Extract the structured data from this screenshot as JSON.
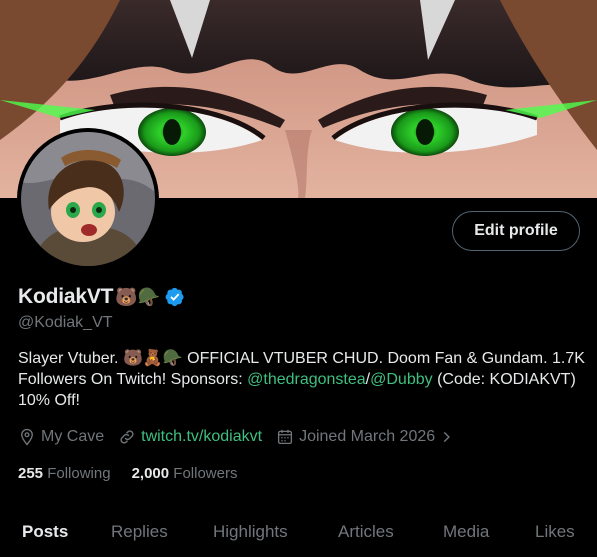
{
  "profile": {
    "display_name": "KodiakVT",
    "name_emojis": "🐻🪖",
    "handle": "@Kodiak_VT",
    "edit_button": "Edit profile",
    "bio_part1": "Slayer Vtuber. ",
    "bio_emojis": "🐻🧸🪖",
    "bio_part2": " OFFICIAL VTUBER CHUD.  Doom Fan & Gundam. 1.7K Followers On Twitch!  Sponsors: ",
    "mention1": "@thedragonstea",
    "slash": "/",
    "mention2": "@Dubby",
    "bio_part3": " (Code: KODIAKVT) 10% Off!",
    "location": "My Cave",
    "website": "twitch.tv/kodiakvt",
    "joined": "Joined March 2026",
    "following_count": "255",
    "following_label": "Following",
    "followers_count": "2,000",
    "followers_label": "Followers"
  },
  "tabs": [
    "Posts",
    "Replies",
    "Highlights",
    "Articles",
    "Media",
    "Likes"
  ],
  "active_tab": "Posts",
  "colors": {
    "accent": "#1d9bf0",
    "link_green": "#3fbf7f",
    "muted": "#71767b",
    "text": "#e7e9ea",
    "background": "#000000"
  },
  "icons": [
    "location-icon",
    "link-icon",
    "calendar-icon",
    "chevron-right-icon",
    "verified-badge-icon"
  ]
}
